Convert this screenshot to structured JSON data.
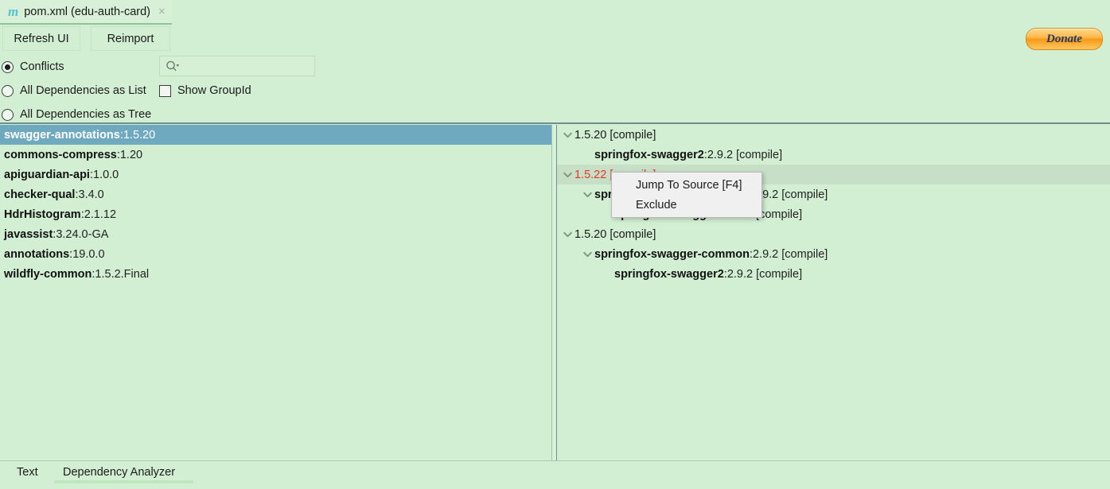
{
  "window": {
    "tab": {
      "icon": "maven-m-icon",
      "label": "pom.xml (edu-auth-card)",
      "close_icon": "×"
    }
  },
  "toolbar": {
    "refresh_label": "Refresh UI",
    "reimport_label": "Reimport",
    "donate_label": "Donate",
    "donate_color": "#f59a17",
    "donate_text_color": "#1f3864"
  },
  "options": {
    "radios": [
      {
        "label": "Conflicts",
        "checked": true
      },
      {
        "label": "All Dependencies as List",
        "checked": false
      },
      {
        "label": "All Dependencies as Tree",
        "checked": false
      }
    ],
    "checkbox": {
      "label": "Show GroupId",
      "checked": false
    },
    "search": {
      "value": "",
      "placeholder": "",
      "icon": "search-icon"
    }
  },
  "left_panel": {
    "selected_index": 0,
    "selection_color": "#6fa9c0",
    "items": [
      {
        "artifact": "swagger-annotations",
        "separator": ":",
        "version": "1.5.20"
      },
      {
        "artifact": "commons-compress",
        "separator": ":",
        "version": "1.20"
      },
      {
        "artifact": "apiguardian-api",
        "separator": ":",
        "version": "1.0.0"
      },
      {
        "artifact": "checker-qual",
        "separator": ":",
        "version": "3.4.0"
      },
      {
        "artifact": "HdrHistogram",
        "separator": ":",
        "version": "2.1.12"
      },
      {
        "artifact": "javassist",
        "separator": ":",
        "version": "3.24.0-GA"
      },
      {
        "artifact": "annotations",
        "separator": ":",
        "version": "19.0.0"
      },
      {
        "artifact": "wildfly-common",
        "separator": ":",
        "version": "1.5.2.Final"
      }
    ]
  },
  "right_panel": {
    "conflict_color": "#e8362a",
    "highlight_color": "#c6dfc6",
    "rows": [
      {
        "level": 0,
        "expandable": true,
        "text": "1.5.20 [compile]",
        "conflict": false,
        "highlight": false,
        "bold_artifact": ""
      },
      {
        "level": 1,
        "expandable": false,
        "artifact": "springfox-swagger2",
        "separator": ":",
        "rest": "2.9.2 [compile]",
        "conflict": false,
        "highlight": false
      },
      {
        "level": 0,
        "expandable": true,
        "text": "1.5.22 [compile]",
        "conflict": true,
        "highlight": true
      },
      {
        "level": 1,
        "expandable": true,
        "artifact": "springfox-swagger-common",
        "separator": ":",
        "rest": "2.9.2 [compile]",
        "conflict": false,
        "highlight": false
      },
      {
        "level": 2,
        "expandable": false,
        "artifact": "springfox-swagger2",
        "separator": ":",
        "rest": "2.9.2 [compile]",
        "conflict": false,
        "highlight": false
      },
      {
        "level": 0,
        "expandable": true,
        "text": "1.5.20 [compile]",
        "conflict": false,
        "highlight": false
      },
      {
        "level": 1,
        "expandable": true,
        "artifact": "springfox-swagger-common",
        "separator": ":",
        "rest": "2.9.2 [compile]",
        "conflict": false,
        "highlight": false
      },
      {
        "level": 2,
        "expandable": false,
        "artifact": "springfox-swagger2",
        "separator": ":",
        "rest": "2.9.2 [compile]",
        "conflict": false,
        "highlight": false
      }
    ]
  },
  "context_menu": {
    "items": [
      {
        "label": "Jump To Source [F4]"
      },
      {
        "label": "Exclude"
      }
    ]
  },
  "bottom_tabs": {
    "items": [
      {
        "label": "Text",
        "selected": false
      },
      {
        "label": "Dependency Analyzer",
        "selected": true
      }
    ]
  }
}
